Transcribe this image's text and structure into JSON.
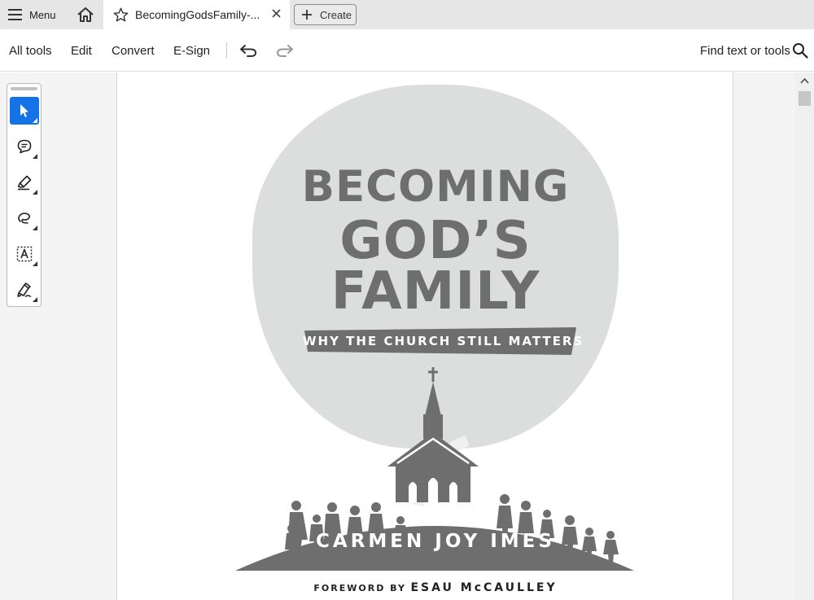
{
  "tabbar": {
    "menu_label": "Menu",
    "tab_title": "BecomingGodsFamily-...",
    "create_label": "Create"
  },
  "toolbar": {
    "all_tools": "All tools",
    "edit": "Edit",
    "convert": "Convert",
    "esign": "E-Sign",
    "find_label": "Find text or tools"
  },
  "tools": [
    {
      "name": "select-tool",
      "icon": "cursor-icon",
      "active": true
    },
    {
      "name": "comment-tool",
      "icon": "comment-icon",
      "active": false
    },
    {
      "name": "highlight-tool",
      "icon": "highlighter-icon",
      "active": false
    },
    {
      "name": "draw-tool",
      "icon": "freehand-icon",
      "active": false
    },
    {
      "name": "text-select-tool",
      "icon": "text-box-icon",
      "active": false
    },
    {
      "name": "sign-tool",
      "icon": "pen-sign-icon",
      "active": false
    }
  ],
  "cover": {
    "title_line1": "BECOMING",
    "title_line2": "GOD’S",
    "title_line3": "FAMILY",
    "subtitle": "WHY THE CHURCH STILL MATTERS",
    "author": "CARMEN JOY IMES",
    "foreword_prefix": "FOREWORD BY",
    "foreword_name": "ESAU McCAULLEY"
  },
  "colors": {
    "accent": "#1473e6",
    "cover_gray": "#6e6e6e",
    "blob_gray": "#dcdedd"
  }
}
